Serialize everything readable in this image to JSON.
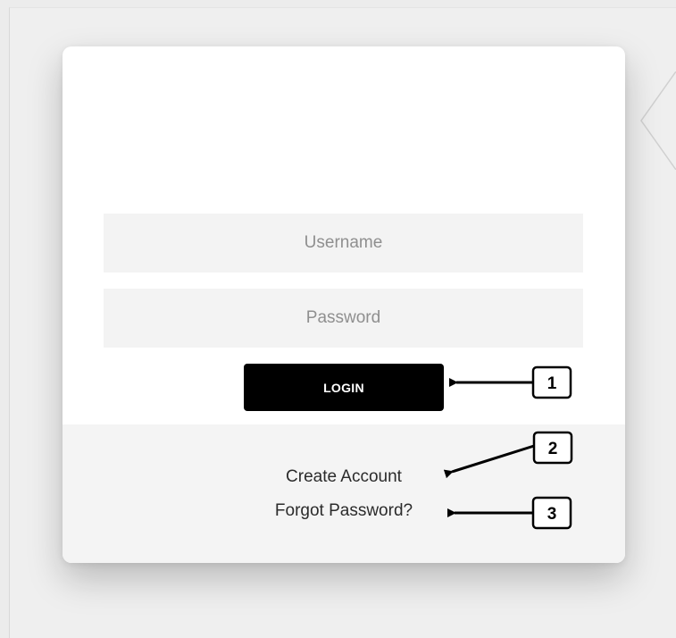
{
  "login_form": {
    "username_placeholder": "Username",
    "password_placeholder": "Password",
    "login_label": "LOGIN"
  },
  "footer_links": {
    "create_account": "Create Account",
    "forgot_password": "Forgot Password?"
  },
  "callouts": [
    {
      "number": "1"
    },
    {
      "number": "2"
    },
    {
      "number": "3"
    }
  ]
}
